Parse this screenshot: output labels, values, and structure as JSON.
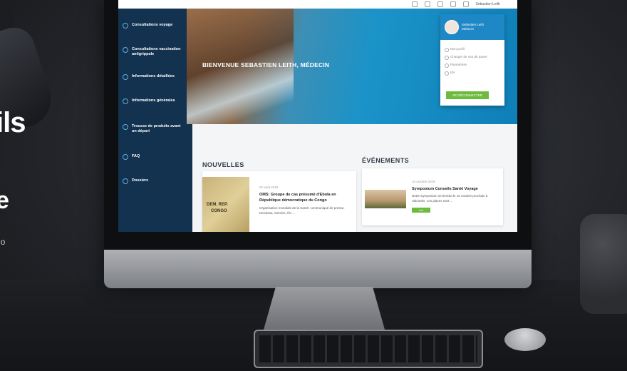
{
  "background_text": {
    "line1": "ils",
    "line2": "e",
    "line3": "io"
  },
  "sidebar": {
    "items": [
      {
        "label": "Consultations voyage",
        "icon": "sun-icon"
      },
      {
        "label": "Consultations vaccination antigrippale",
        "icon": "syringe-icon"
      },
      {
        "label": "Informations détaillées",
        "icon": "info-icon"
      },
      {
        "label": "Informations générales",
        "icon": "pills-icon"
      },
      {
        "label": "Trousse de produits avant un départ",
        "icon": "first-aid-kit-icon"
      },
      {
        "label": "FAQ",
        "icon": "question-icon"
      },
      {
        "label": "Dossiers",
        "icon": "folder-icon"
      }
    ]
  },
  "topbar": {
    "user_label": "Sebastien Leith"
  },
  "hero": {
    "title": "BIENVENUE SEBASTIEN LEITH, MÉDECIN"
  },
  "popup": {
    "name": "Sebastien Leith",
    "role": "Médecin",
    "menu": [
      "Mon profil",
      "Changer de mot de passe",
      "Paramètres"
    ],
    "language": "EN",
    "logout_label": "SE DÉCONNECTER"
  },
  "news": {
    "section_title": "NOUVELLES",
    "date": "02 août 2019",
    "title": "OMS: Groupe de cas présumé d'Ebola en République démocratique du Congo",
    "excerpt": "Organisation mondiale de la Santé: communiqué de presse. Kinshasa, Genève, fév ..."
  },
  "map_labels": {
    "a": "DEM. REP.",
    "b": "CONGO"
  },
  "events": {
    "section_title": "ÉVÉNEMENTS",
    "date": "16 octobre 2019",
    "title": "Symposium Conseils Santé Voyage",
    "excerpt": "Notre Symposium se tiendra le 16 octobre prochain à Valcartier. Les places sont ...",
    "button": "Lire"
  },
  "colors": {
    "sidebar": "#12324f",
    "accent": "#1e88c7",
    "green": "#6dbb3c"
  }
}
